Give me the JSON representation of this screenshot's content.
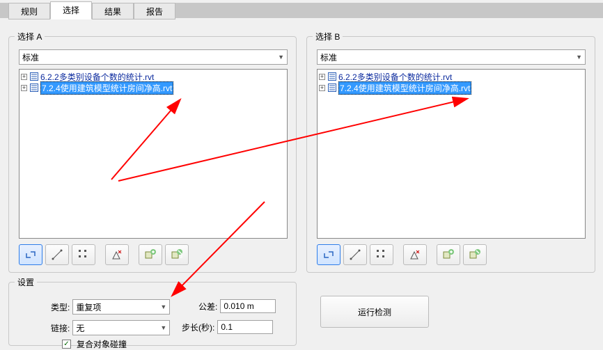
{
  "tabs": {
    "rules": "规则",
    "select": "选择",
    "results": "结果",
    "report": "报告"
  },
  "panelA": {
    "title": "选择 A",
    "combo": "标准",
    "tree": [
      {
        "label": "6.2.2多类别设备个数的统计.rvt",
        "selected": false
      },
      {
        "label": "7.2.4使用建筑模型统计房间净高.rvt",
        "selected": true
      }
    ]
  },
  "panelB": {
    "title": "选择 B",
    "combo": "标准",
    "tree": [
      {
        "label": "6.2.2多类别设备个数的统计.rvt",
        "selected": false
      },
      {
        "label": "7.2.4使用建筑模型统计房间净高.rvt",
        "selected": true
      }
    ]
  },
  "settings": {
    "title": "设置",
    "typeLabel": "类型:",
    "typeValue": "重复项",
    "toleranceLabel": "公差:",
    "toleranceValue": "0.010 m",
    "linkLabel": "链接:",
    "linkValue": "无",
    "stepLabel": "步长(秒):",
    "stepValue": "0.1",
    "checkboxLabel": "复合对象碰撞"
  },
  "runLabel": "运行检测"
}
